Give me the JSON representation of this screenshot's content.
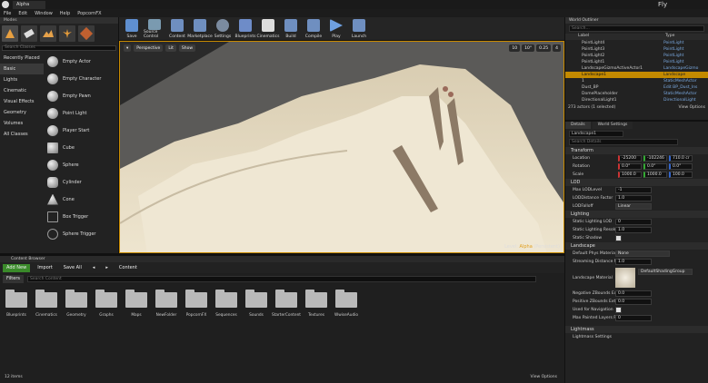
{
  "window": {
    "tab_title": "Alpha",
    "fly_label": "Fly",
    "help_search_placeholder": "Search For Help"
  },
  "menu": [
    "File",
    "Edit",
    "Window",
    "Help",
    "PopcornFX"
  ],
  "modes": {
    "title": "Modes",
    "search_placeholder": "Search Classes",
    "categories": [
      "Recently Placed",
      "Basic",
      "Lights",
      "Cinematic",
      "Visual Effects",
      "Geometry",
      "Volumes",
      "All Classes"
    ],
    "items": [
      "Empty Actor",
      "Empty Character",
      "Empty Pawn",
      "Point Light",
      "Player Start",
      "Cube",
      "Sphere",
      "Cylinder",
      "Cone",
      "Box Trigger",
      "Sphere Trigger"
    ]
  },
  "toolbar": [
    "Save",
    "Source Control",
    "Content",
    "Marketplace",
    "Settings",
    "Blueprints",
    "Cinematics",
    "Build",
    "Compile",
    "Play",
    "Launch"
  ],
  "viewport": {
    "perspective": "Perspective",
    "lit": "Lit",
    "show": "Show",
    "grid": "10",
    "rot": "10°",
    "scale": "0.25",
    "cam": "4",
    "level_prefix": "Level: ",
    "level_name": "Alpha",
    "level_suffix": " (Persistent)"
  },
  "outliner": {
    "title": "World Outliner",
    "search_placeholder": "Search...",
    "col_label": "Label",
    "col_type": "Type",
    "rows": [
      {
        "label": "PointLight4",
        "type": "PointLight"
      },
      {
        "label": "PointLight3",
        "type": "PointLight"
      },
      {
        "label": "PointLight2",
        "type": "PointLight"
      },
      {
        "label": "PointLight1",
        "type": "PointLight"
      },
      {
        "label": "LandscapeGizmoActiveActor1",
        "type": "LandscapeGizmo"
      },
      {
        "label": "Landscape1",
        "type": "Landscape"
      },
      {
        "label": "1",
        "type": "StaticMeshActor"
      },
      {
        "label": "Dust_BP",
        "type": "Edit BP_Dust_Ins"
      },
      {
        "label": "DomePlaceholder",
        "type": "StaticMeshActor"
      },
      {
        "label": "DirectionalLight1",
        "type": "DirectionalLight"
      }
    ],
    "status": "273 actors (1 selected)",
    "view_options": "View Options"
  },
  "details": {
    "tab_details": "Details",
    "tab_world": "World Settings",
    "name": "Landscape1",
    "search_placeholder": "Search Details",
    "transform": "Transform",
    "location_label": "Location",
    "location": [
      "-25200",
      "-102246",
      "710.0 cr"
    ],
    "rotation_label": "Rotation",
    "rotation": [
      "0.0°",
      "0.0°",
      "0.0°"
    ],
    "scale_label": "Scale",
    "scale": [
      "1000.0",
      "1000.0",
      "100.0"
    ],
    "lod": "LOD",
    "lod_rows": [
      {
        "k": "Max LODLevel",
        "v": "-1"
      },
      {
        "k": "LODDistance Factor",
        "v": "1.0"
      },
      {
        "k": "LODFalloff",
        "v": "Linear"
      }
    ],
    "lighting": "Lighting",
    "light_rows": [
      {
        "k": "Static Lighting LOD",
        "v": "0"
      },
      {
        "k": "Static Lighting Resolu",
        "v": "1.0"
      },
      {
        "k": "Static Shadow",
        "v": ""
      }
    ],
    "landscape": "Landscape",
    "land_rows": [
      {
        "k": "Default Phys Material",
        "v": "None"
      },
      {
        "k": "Streaming Distance M",
        "v": "1.0"
      },
      {
        "k": "Landscape Material",
        "v": "DefaultShadingGroup"
      },
      {
        "k": "Negative ZBounds Ext",
        "v": "0.0"
      },
      {
        "k": "Positive ZBounds Ext",
        "v": "0.0"
      },
      {
        "k": "Used for Navigation",
        "v": ""
      },
      {
        "k": "Max Painted Layers P",
        "v": "0"
      }
    ],
    "lightmass": "Lightmass",
    "lightmass_settings": "Lightmass Settings"
  },
  "content": {
    "title": "Content Browser",
    "add_new": "Add New",
    "import": "Import",
    "save_all": "Save All",
    "path": "Content",
    "filters": "Filters",
    "search_placeholder": "Search Content",
    "folders": [
      "Blueprints",
      "Cinematics",
      "Geometry",
      "Graphs",
      "Maps",
      "NewFolder",
      "PopcornFX",
      "Sequences",
      "Sounds",
      "StarterContent",
      "Textures",
      "WwiseAudio"
    ],
    "count": "12 items",
    "view_options": "View Options"
  }
}
